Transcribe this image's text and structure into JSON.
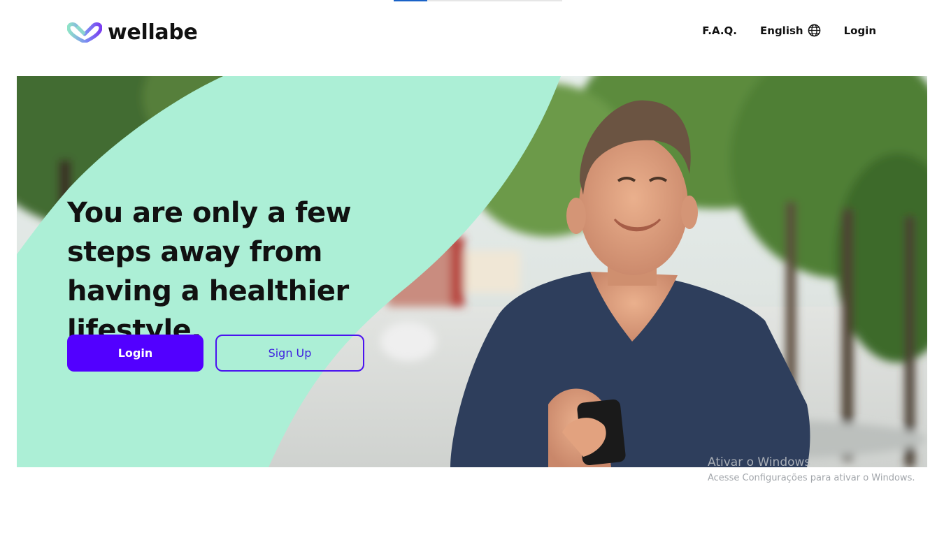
{
  "header": {
    "logo_text": "wellabe",
    "nav": {
      "faq_label": "F.A.Q.",
      "language_label": "English",
      "login_label": "Login"
    }
  },
  "hero": {
    "headline": "You are only a few steps away from having a healthier lifestyle.",
    "login_button": "Login",
    "signup_button": "Sign Up"
  },
  "watermark": {
    "title": "Ativar o Windows",
    "subtitle": "Acesse Configurações para ativar o Windows."
  },
  "colors": {
    "brand_purple": "#5200ff",
    "mint": "#acefd6",
    "text_dark": "#111111"
  },
  "icons": {
    "language": "globe-icon",
    "logo": "wellabe-heart-logo-icon"
  }
}
